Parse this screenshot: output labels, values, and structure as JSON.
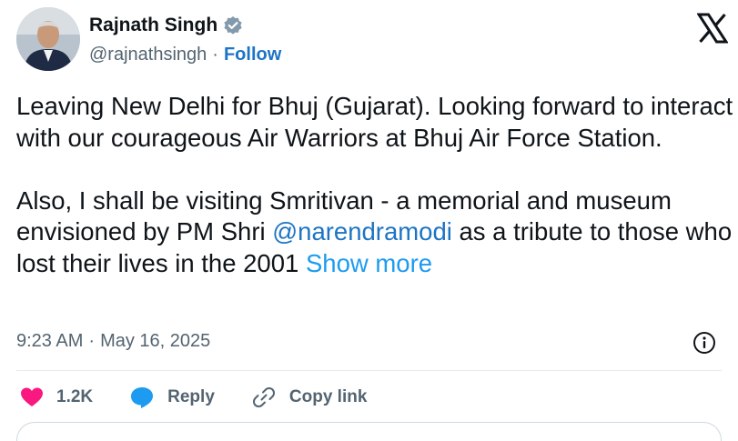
{
  "author": {
    "display_name": "Rajnath Singh",
    "handle": "@rajnathsingh",
    "separator": "·",
    "follow_label": "Follow",
    "verified": true
  },
  "tweet": {
    "text_before_mention": "Leaving New Delhi for Bhuj (Gujarat). Looking forward to interact with our courageous Air Warriors at Bhuj Air Force Station.\n\nAlso, I shall be visiting Smritivan - a memorial and museum envisioned by PM Shri ",
    "mention": "@narendramodi",
    "text_after_mention": " as a tribute to those who lost their lives in the 2001 ",
    "show_more_label": "Show more"
  },
  "meta": {
    "time": "9:23 AM",
    "separator": "·",
    "date": "May 16, 2025"
  },
  "actions": {
    "like_count": "1.2K",
    "reply_label": "Reply",
    "copy_link_label": "Copy link"
  },
  "colors": {
    "link": "#1d74c3",
    "show_more": "#1d9bf0",
    "like": "#f91880",
    "reply": "#1d9bf0",
    "verified": "#829aab",
    "secondary_text": "#536471"
  },
  "icons": {
    "verified": "verified-badge-icon",
    "x_logo": "x-logo-icon",
    "info": "info-icon",
    "like": "heart-icon",
    "reply": "speech-bubble-icon",
    "copy_link": "link-icon"
  }
}
